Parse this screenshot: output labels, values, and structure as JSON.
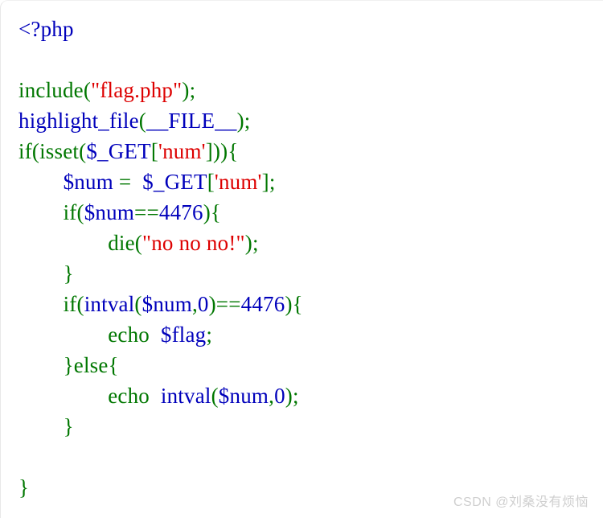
{
  "page": {
    "background_color": "#ffffff",
    "kind": "php-highlight_file-output"
  },
  "palette": {
    "default": "#0000BB",
    "keyword": "#007700",
    "string": "#DD0000",
    "comment": "#FF8000",
    "html": "#000000",
    "watermark": "#cfcfcf",
    "border": "#e8e8e8"
  },
  "code": {
    "language": "php",
    "raw": "<?php\n\ninclude(\"flag.php\");\nhighlight_file(__FILE__);\nif(isset($_GET['num'])){\n    $num = $_GET['num'];\n    if($num==4476){\n        die(\"no no no!\");\n    }\n    if(intval($num,0)==4476){\n        echo $flag;\n    }else{\n        echo intval($num,0);\n    }\n}",
    "lines": [
      {
        "n": 1,
        "indent": 0,
        "tokens": [
          {
            "t": "<?php",
            "c": "default"
          }
        ]
      },
      {
        "n": 2,
        "indent": 0,
        "tokens": []
      },
      {
        "n": 3,
        "indent": 0,
        "tokens": [
          {
            "t": "include",
            "c": "keyword"
          },
          {
            "t": "(",
            "c": "keyword"
          },
          {
            "t": "\"flag.php\"",
            "c": "string"
          },
          {
            "t": ")",
            "c": "keyword"
          },
          {
            "t": ";",
            "c": "keyword"
          }
        ]
      },
      {
        "n": 4,
        "indent": 0,
        "tokens": [
          {
            "t": "highlight_file",
            "c": "default"
          },
          {
            "t": "(",
            "c": "keyword"
          },
          {
            "t": "__FILE__",
            "c": "default"
          },
          {
            "t": ")",
            "c": "keyword"
          },
          {
            "t": ";",
            "c": "keyword"
          }
        ]
      },
      {
        "n": 5,
        "indent": 0,
        "tokens": [
          {
            "t": "if",
            "c": "keyword"
          },
          {
            "t": "(",
            "c": "keyword"
          },
          {
            "t": "isset",
            "c": "keyword"
          },
          {
            "t": "(",
            "c": "keyword"
          },
          {
            "t": "$_GET",
            "c": "default"
          },
          {
            "t": "[",
            "c": "keyword"
          },
          {
            "t": "'num'",
            "c": "string"
          },
          {
            "t": "]",
            "c": "keyword"
          },
          {
            "t": ")",
            "c": "keyword"
          },
          {
            "t": ")",
            "c": "keyword"
          },
          {
            "t": "{",
            "c": "keyword"
          }
        ]
      },
      {
        "n": 6,
        "indent": 1,
        "tokens": [
          {
            "t": "$num",
            "c": "default"
          },
          {
            "t": " = ",
            "c": "keyword"
          },
          {
            "t": " ",
            "c": "html"
          },
          {
            "t": "$_GET",
            "c": "default"
          },
          {
            "t": "[",
            "c": "keyword"
          },
          {
            "t": "'num'",
            "c": "string"
          },
          {
            "t": "]",
            "c": "keyword"
          },
          {
            "t": ";",
            "c": "keyword"
          }
        ]
      },
      {
        "n": 7,
        "indent": 1,
        "tokens": [
          {
            "t": "if",
            "c": "keyword"
          },
          {
            "t": "(",
            "c": "keyword"
          },
          {
            "t": "$num",
            "c": "default"
          },
          {
            "t": "==",
            "c": "keyword"
          },
          {
            "t": "4476",
            "c": "default"
          },
          {
            "t": ")",
            "c": "keyword"
          },
          {
            "t": "{",
            "c": "keyword"
          }
        ]
      },
      {
        "n": 8,
        "indent": 2,
        "tokens": [
          {
            "t": "die",
            "c": "keyword"
          },
          {
            "t": "(",
            "c": "keyword"
          },
          {
            "t": "\"no no no!\"",
            "c": "string"
          },
          {
            "t": ")",
            "c": "keyword"
          },
          {
            "t": ";",
            "c": "keyword"
          }
        ]
      },
      {
        "n": 9,
        "indent": 1,
        "tokens": [
          {
            "t": "}",
            "c": "keyword"
          }
        ]
      },
      {
        "n": 10,
        "indent": 1,
        "tokens": [
          {
            "t": "if",
            "c": "keyword"
          },
          {
            "t": "(",
            "c": "keyword"
          },
          {
            "t": "intval",
            "c": "default"
          },
          {
            "t": "(",
            "c": "keyword"
          },
          {
            "t": "$num",
            "c": "default"
          },
          {
            "t": ",",
            "c": "keyword"
          },
          {
            "t": "0",
            "c": "default"
          },
          {
            "t": ")",
            "c": "keyword"
          },
          {
            "t": "==",
            "c": "keyword"
          },
          {
            "t": "4476",
            "c": "default"
          },
          {
            "t": ")",
            "c": "keyword"
          },
          {
            "t": "{",
            "c": "keyword"
          }
        ]
      },
      {
        "n": 11,
        "indent": 2,
        "tokens": [
          {
            "t": "echo",
            "c": "keyword"
          },
          {
            "t": "  ",
            "c": "html"
          },
          {
            "t": "$flag",
            "c": "default"
          },
          {
            "t": ";",
            "c": "keyword"
          }
        ]
      },
      {
        "n": 12,
        "indent": 1,
        "tokens": [
          {
            "t": "}",
            "c": "keyword"
          },
          {
            "t": "else",
            "c": "keyword"
          },
          {
            "t": "{",
            "c": "keyword"
          }
        ]
      },
      {
        "n": 13,
        "indent": 2,
        "tokens": [
          {
            "t": "echo",
            "c": "keyword"
          },
          {
            "t": "  ",
            "c": "html"
          },
          {
            "t": "intval",
            "c": "default"
          },
          {
            "t": "(",
            "c": "keyword"
          },
          {
            "t": "$num",
            "c": "default"
          },
          {
            "t": ",",
            "c": "keyword"
          },
          {
            "t": "0",
            "c": "default"
          },
          {
            "t": ")",
            "c": "keyword"
          },
          {
            "t": ";",
            "c": "keyword"
          }
        ]
      },
      {
        "n": 14,
        "indent": 1,
        "tokens": [
          {
            "t": "}",
            "c": "keyword"
          }
        ]
      },
      {
        "n": 15,
        "indent": 0,
        "tokens": []
      },
      {
        "n": 16,
        "indent": 0,
        "tokens": [
          {
            "t": "}",
            "c": "keyword"
          }
        ]
      }
    ]
  },
  "watermark": {
    "text": "CSDN @刘桑没有烦恼"
  }
}
